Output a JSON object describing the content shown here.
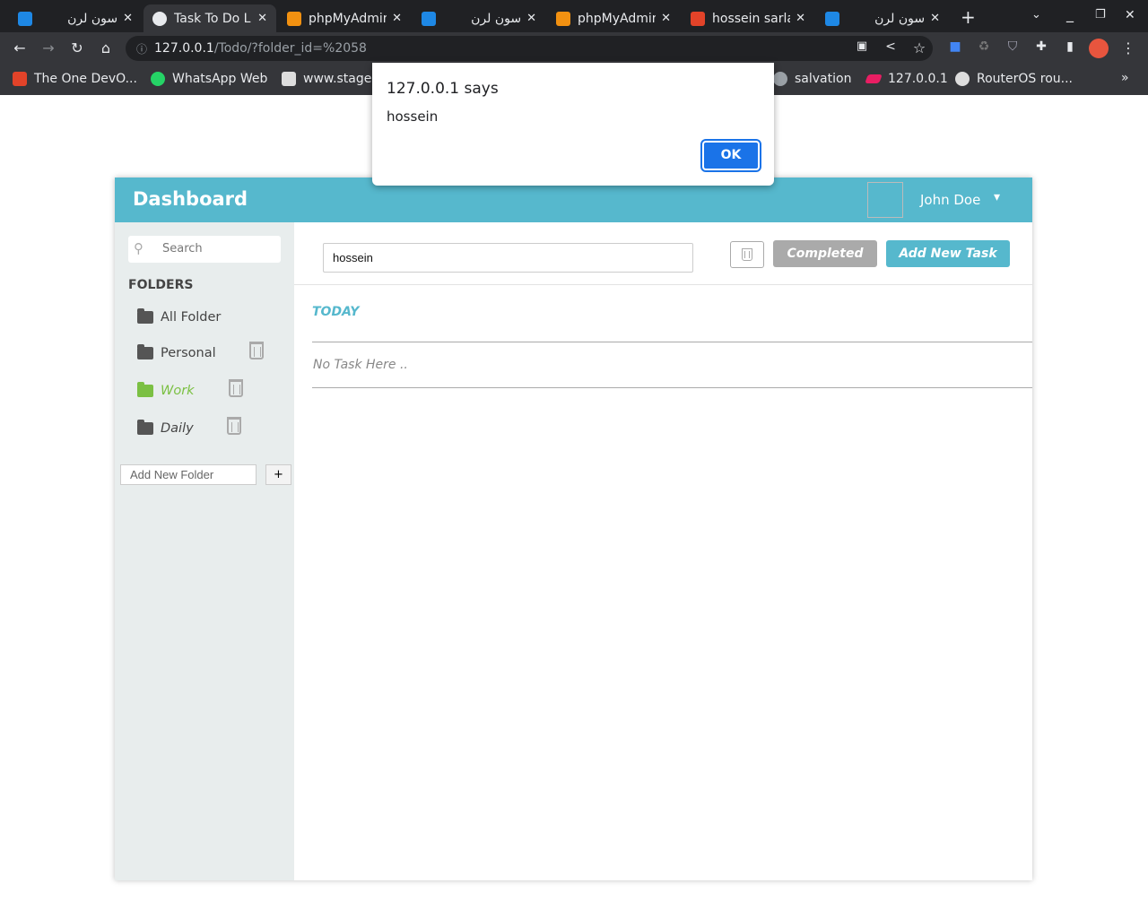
{
  "browser": {
    "tabs": [
      {
        "label": "سون لرن",
        "icon": "sevenlearn-icon",
        "color": "#1e88e5"
      },
      {
        "label": "Task To Do L",
        "icon": "globe-icon",
        "color": "#e8eaed",
        "active": true
      },
      {
        "label": "phpMyAdmin",
        "icon": "phpmyadmin-icon",
        "color": "#f29111"
      },
      {
        "label": "سون لرن",
        "icon": "sevenlearn-icon",
        "color": "#1e88e5"
      },
      {
        "label": "phpMyAdmin",
        "icon": "phpmyadmin-icon",
        "color": "#f29111"
      },
      {
        "label": "hossein sarla",
        "icon": "gitlab-icon",
        "color": "#e24329"
      },
      {
        "label": "سون لرن",
        "icon": "sevenlearn-icon",
        "color": "#1e88e5"
      }
    ],
    "url_host": "127.0.0.1",
    "url_path": "/Todo/?folder_id=%2058",
    "bookmarks": [
      {
        "label": "The One DevO...",
        "icon": "gitlab-icon",
        "color": "#e24329"
      },
      {
        "label": "WhatsApp Web",
        "icon": "whatsapp-icon",
        "color": "#25d366"
      },
      {
        "label": "www.stage",
        "icon": "stage-icon",
        "color": "#ddd"
      },
      {
        "label": "salvation",
        "icon": "globe-icon",
        "color": "#9aa0a6"
      },
      {
        "label": "127.0.0.1",
        "icon": "slashes-icon",
        "color": "#e91e63"
      },
      {
        "label": "RouterOS rou...",
        "icon": "routeros-icon",
        "color": "#ddd"
      }
    ]
  },
  "dialog": {
    "title": "127.0.0.1 says",
    "message": "hossein",
    "ok": "OK"
  },
  "header": {
    "title": "Dashboard",
    "user": "John Doe"
  },
  "sidebar": {
    "search_placeholder": "Search",
    "folders_label": "FOLDERS",
    "folders": [
      {
        "label": "All Folder"
      },
      {
        "label": "Personal"
      },
      {
        "label": "Work",
        "active": true
      },
      {
        "label": "Daily"
      }
    ],
    "new_folder_placeholder": "Add New Folder",
    "add": "+"
  },
  "main": {
    "task_input": "hossein",
    "completed": "Completed",
    "add_task": "Add New Task",
    "section": "TODAY",
    "empty": "No Task Here .."
  },
  "colors": {
    "accent": "#56b8cd",
    "active_folder": "#7bc043",
    "completed_btn": "#aaaaaa"
  }
}
